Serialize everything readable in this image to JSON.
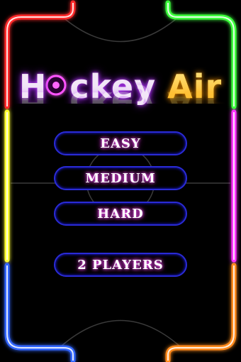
{
  "title": {
    "word1_before": "H",
    "word1_after": "ckey",
    "word2": "Air"
  },
  "menu": {
    "easy": "EASY",
    "medium": "MEDIUM",
    "hard": "HARD",
    "two_players": "2 PLAYERS"
  },
  "colors": {
    "background": "#000000",
    "rail_top_left": "#ff2a2a",
    "rail_top_right": "#3dff3d",
    "rail_left_mid": "#ffff33",
    "rail_right_mid": "#ff33ff",
    "rail_bottom_left": "#3366ff",
    "rail_bottom_right": "#ff8a1a",
    "button_border": "#2a2bd6"
  }
}
